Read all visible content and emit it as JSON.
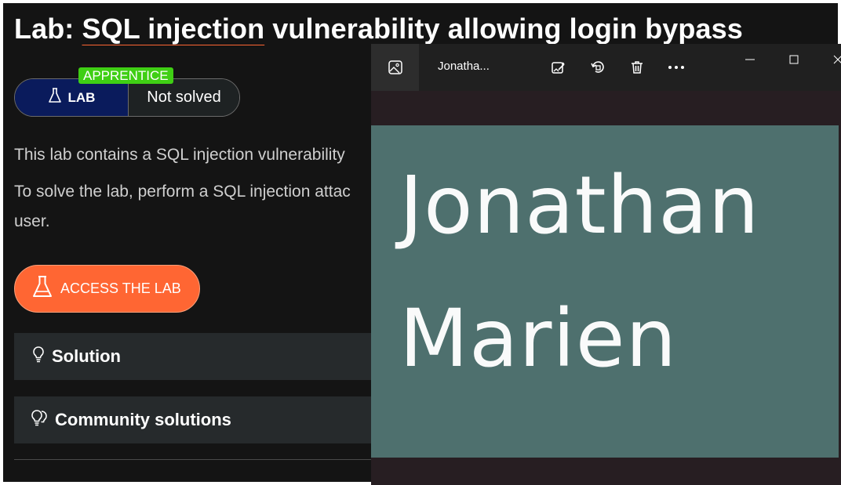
{
  "lab": {
    "title_prefix": "Lab: ",
    "title_topic": "SQL injection",
    "title_suffix": " vulnerability allowing login bypass",
    "level_badge": "APPRENTICE",
    "lab_label": "LAB",
    "status": "Not solved",
    "description_1": "This lab contains a SQL injection vulnerability",
    "description_2": "To solve the lab, perform a SQL injection attac",
    "description_3": "user.",
    "access_button": "ACCESS THE LAB",
    "accordions": [
      {
        "label": "Solution",
        "icon": "lightbulb-icon"
      },
      {
        "label": "Community solutions",
        "icon": "lightbulbs-icon"
      }
    ]
  },
  "photos_app": {
    "file_name": "Jonatha...",
    "toolbar_icons": [
      "gallery-icon",
      "edit-image-icon",
      "rotate-icon",
      "delete-icon",
      "more-icon"
    ],
    "window_controls": [
      "minimize-icon",
      "maximize-icon",
      "close-icon"
    ],
    "image_text_line1": "Jonathan",
    "image_text_line2": "Marien"
  },
  "colors": {
    "page_background": "#141414",
    "accent_orange": "#ff6633",
    "badge_green": "#3fcf14",
    "lab_navy": "#0a1b5c",
    "photo_teal": "#4e706e"
  }
}
